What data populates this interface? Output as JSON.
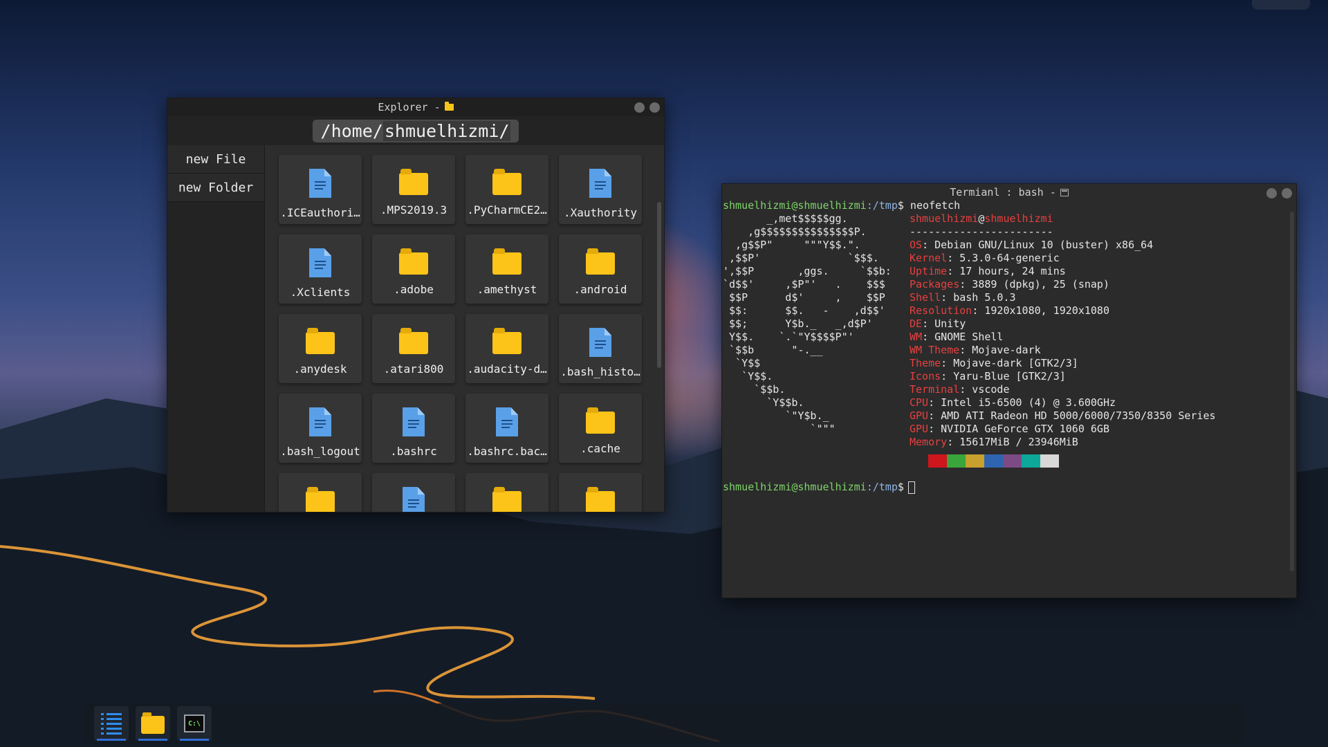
{
  "explorer": {
    "title": "Explorer - ",
    "path_prefix": "/home/",
    "path_segment": "shmuelhizmi/",
    "sidebar": [
      {
        "label": "new File"
      },
      {
        "label": "new Folder"
      }
    ],
    "items": [
      {
        "name": ".ICEauthori…",
        "type": "file"
      },
      {
        "name": ".MPS2019.3",
        "type": "folder"
      },
      {
        "name": ".PyCharmCE2…",
        "type": "folder"
      },
      {
        "name": ".Xauthority",
        "type": "file"
      },
      {
        "name": ".Xclients",
        "type": "file"
      },
      {
        "name": ".adobe",
        "type": "folder"
      },
      {
        "name": ".amethyst",
        "type": "folder"
      },
      {
        "name": ".android",
        "type": "folder"
      },
      {
        "name": ".anydesk",
        "type": "folder"
      },
      {
        "name": ".atari800",
        "type": "folder"
      },
      {
        "name": ".audacity-d…",
        "type": "folder"
      },
      {
        "name": ".bash_histo…",
        "type": "file"
      },
      {
        "name": ".bash_logout",
        "type": "file"
      },
      {
        "name": ".bashrc",
        "type": "file"
      },
      {
        "name": ".bashrc.bac…",
        "type": "file"
      },
      {
        "name": ".cache",
        "type": "folder"
      },
      {
        "name": "",
        "type": "folder"
      },
      {
        "name": "",
        "type": "file"
      },
      {
        "name": "",
        "type": "folder"
      },
      {
        "name": "",
        "type": "folder"
      }
    ]
  },
  "terminal": {
    "title": "Termianl : bash - ",
    "prompt_user": "shmuelhizmi@shmuelhizmi",
    "prompt_dir": ":/tmp",
    "prompt_symbol": "$",
    "command": " neofetch",
    "logo_lines": [
      "       _,met$$$$$gg.",
      "    ,g$$$$$$$$$$$$$$$P.",
      "  ,g$$P\"     \"\"\"Y$$.\".",
      " ,$$P'              `$$$.",
      "',$$P       ,ggs.     `$$b:",
      "`d$$'     ,$P\"'   .    $$$",
      " $$P      d$'     ,    $$P",
      " $$:      $$.   -    ,d$$'",
      " $$;      Y$b._   _,d$P'",
      " Y$$.    `.`\"Y$$$$P\"'",
      " `$$b      \"-.__",
      "  `Y$$",
      "   `Y$$.",
      "     `$$b.",
      "       `Y$$b.",
      "          `\"Y$b._",
      "              `\"\"\""
    ],
    "host_user": "shmuelhizmi",
    "host_at": "@",
    "host_name": "shmuelhizmi",
    "separator": "-----------------------",
    "info": [
      {
        "key": "OS",
        "value": ": Debian GNU/Linux 10 (buster) x86_64"
      },
      {
        "key": "Kernel",
        "value": ": 5.3.0-64-generic"
      },
      {
        "key": "Uptime",
        "value": ": 17 hours, 24 mins"
      },
      {
        "key": "Packages",
        "value": ": 3889 (dpkg), 25 (snap)"
      },
      {
        "key": "Shell",
        "value": ": bash 5.0.3"
      },
      {
        "key": "Resolution",
        "value": ": 1920x1080, 1920x1080"
      },
      {
        "key": "DE",
        "value": ": Unity"
      },
      {
        "key": "WM",
        "value": ": GNOME Shell"
      },
      {
        "key": "WM Theme",
        "value": ": Mojave-dark"
      },
      {
        "key": "Theme",
        "value": ": Mojave-dark [GTK2/3]"
      },
      {
        "key": "Icons",
        "value": ": Yaru-Blue [GTK2/3]"
      },
      {
        "key": "Terminal",
        "value": ": vscode"
      },
      {
        "key": "CPU",
        "value": ": Intel i5-6500 (4) @ 3.600GHz"
      },
      {
        "key": "GPU",
        "value": ": AMD ATI Radeon HD 5000/6000/7350/8350 Series"
      },
      {
        "key": "GPU",
        "value": ": NVIDIA GeForce GTX 1060 6GB"
      },
      {
        "key": "Memory",
        "value": ": 15617MiB / 23946MiB"
      }
    ],
    "palette": [
      "#2b2b2b",
      "#d0161d",
      "#3aa53a",
      "#c7a02d",
      "#2f65b0",
      "#7c4b86",
      "#0ea89a",
      "#d8d8d8"
    ]
  },
  "taskbar": {
    "apps": [
      {
        "icon": "app-menu-icon",
        "active": true
      },
      {
        "icon": "folder-icon",
        "active": true
      },
      {
        "icon": "terminal-icon",
        "active": true,
        "label": "C:\\"
      }
    ]
  },
  "colors": {
    "accent": "#2f6fd6",
    "folder": "#fcc418",
    "file": "#5aa0e8",
    "prompt_green": "#7fd36a",
    "prompt_blue": "#8fb5e8",
    "neofetch_red": "#e8403f"
  }
}
